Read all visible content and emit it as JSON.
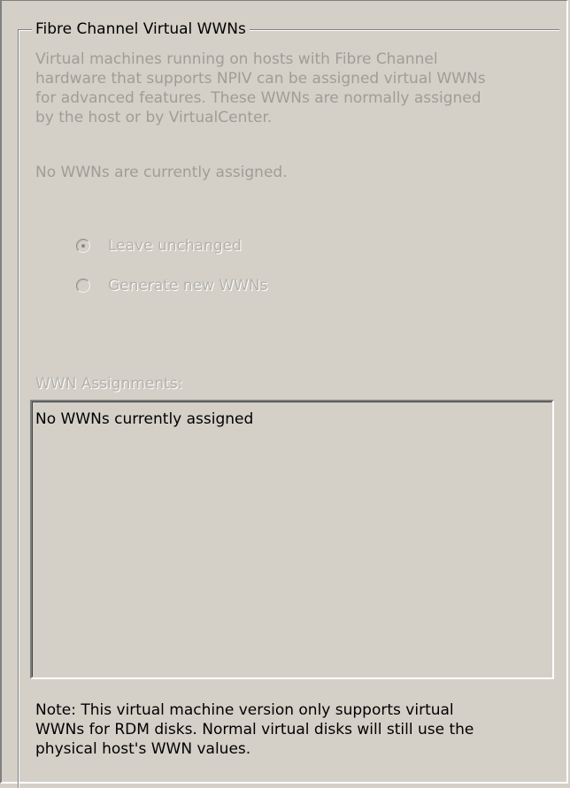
{
  "group": {
    "title": "Fibre Channel Virtual WWNs"
  },
  "description": "Virtual machines running on hosts with Fibre Channel\nhardware that supports NPIV can be assigned virtual WWNs\nfor advanced features. These WWNs are normally assigned\nby the host or by VirtualCenter.",
  "status": "No WWNs are currently assigned.",
  "options": [
    {
      "label": "Leave unchanged",
      "checked": true
    },
    {
      "label": "Generate new WWNs",
      "checked": false
    }
  ],
  "assignments": {
    "label": "WWN Assignments:",
    "items": [
      "No WWNs currently assigned"
    ]
  },
  "note": "Note: This virtual machine version only supports virtual\nWWNs for RDM disks. Normal virtual disks will still use the\nphysical host's WWN values."
}
